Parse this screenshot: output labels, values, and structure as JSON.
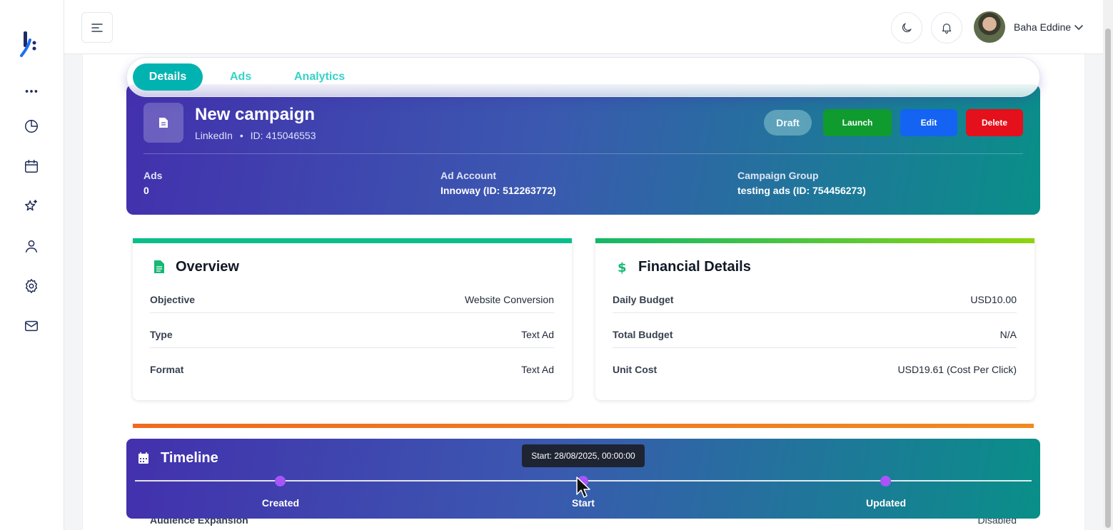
{
  "header": {
    "user_name": "Baha Eddine"
  },
  "sidebar": {
    "items": [
      {
        "icon": "more-icon"
      },
      {
        "icon": "pie-chart-icon"
      },
      {
        "icon": "calendar-icon"
      },
      {
        "icon": "sparkle-star-icon"
      },
      {
        "icon": "user-icon"
      },
      {
        "icon": "settings-gear-icon"
      },
      {
        "icon": "mail-icon"
      }
    ]
  },
  "tabs": [
    {
      "label": "Details",
      "active": true
    },
    {
      "label": "Ads",
      "active": false
    },
    {
      "label": "Analytics",
      "active": false
    }
  ],
  "campaign": {
    "title": "New campaign",
    "platform": "LinkedIn",
    "separator": "•",
    "id_text": "ID: 415046553",
    "status": "Draft",
    "actions": {
      "launch": "Launch",
      "edit": "Edit",
      "delete": "Delete"
    },
    "meta": [
      {
        "label": "Ads",
        "value": "0"
      },
      {
        "label": "Ad Account",
        "value": "Innoway (ID: 512263772)"
      },
      {
        "label": "Campaign Group",
        "value": "testing ads (ID: 754456273)"
      }
    ]
  },
  "overview": {
    "title": "Overview",
    "accent": "#0bbf8c",
    "rows": [
      {
        "key": "Objective",
        "value": "Website Conversion"
      },
      {
        "key": "Type",
        "value": "Text Ad"
      },
      {
        "key": "Format",
        "value": "Text Ad"
      }
    ]
  },
  "financial": {
    "title": "Financial Details",
    "accent": "#20c05c",
    "rows": [
      {
        "key": "Daily Budget",
        "value": "USD10.00"
      },
      {
        "key": "Total Budget",
        "value": "N/A"
      },
      {
        "key": "Unit Cost",
        "value": "USD19.61 (Cost Per Click)"
      }
    ]
  },
  "audience": {
    "key": "Audience Expansion",
    "value": "Disabled"
  },
  "timeline": {
    "title": "Timeline",
    "points": [
      {
        "label": "Created"
      },
      {
        "label": "Start"
      },
      {
        "label": "Updated"
      }
    ],
    "tooltip": "Start: 28/08/2025, 00:00:00"
  },
  "colors": {
    "primary_teal": "#00b3b0",
    "launch": "#0f9b2e",
    "edit": "#1463f3",
    "delete": "#e4101b",
    "timeline_dot": "#a855f7"
  }
}
